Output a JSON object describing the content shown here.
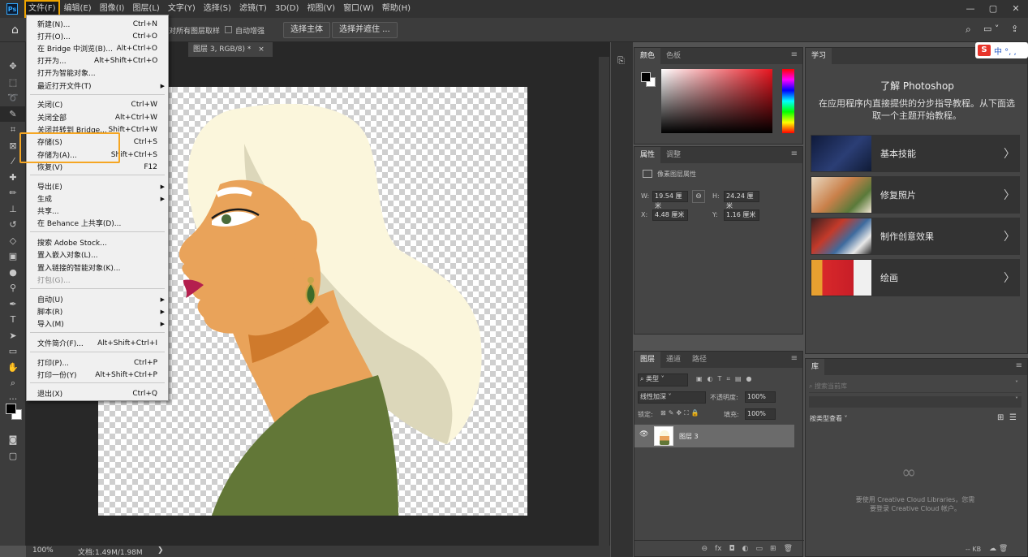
{
  "menubar": {
    "logo": "Ps",
    "items": [
      "文件(F)",
      "编辑(E)",
      "图像(I)",
      "图层(L)",
      "文字(Y)",
      "选择(S)",
      "滤镜(T)",
      "3D(D)",
      "视图(V)",
      "窗口(W)",
      "帮助(H)"
    ],
    "window_controls": [
      "—",
      "▢",
      "✕"
    ]
  },
  "optionsbar": {
    "sample_all": "对所有图层取样",
    "auto_enhance": "自动增强",
    "select_subject": "选择主体",
    "select_and_mask": "选择并遮住 ..."
  },
  "document": {
    "tab_title": "图层 3, RGB/8) *",
    "tab_close": "×",
    "zoom": "100%",
    "doc_info": "文档:1.49M/1.98M",
    "status_arrow": "❯"
  },
  "file_menu": {
    "items": [
      {
        "label": "新建(N)...",
        "shortcut": "Ctrl+N"
      },
      {
        "label": "打开(O)...",
        "shortcut": "Ctrl+O"
      },
      {
        "label": "在 Bridge 中浏览(B)...",
        "shortcut": "Alt+Ctrl+O"
      },
      {
        "label": "打开为...",
        "shortcut": "Alt+Shift+Ctrl+O"
      },
      {
        "label": "打开为智能对象...",
        "shortcut": ""
      },
      {
        "label": "最近打开文件(T)",
        "shortcut": "",
        "submenu": true
      },
      {
        "label": "关闭(C)",
        "shortcut": "Ctrl+W"
      },
      {
        "label": "关闭全部",
        "shortcut": "Alt+Ctrl+W"
      },
      {
        "label": "关闭并转到 Bridge...",
        "shortcut": "Shift+Ctrl+W"
      },
      {
        "label": "存储(S)",
        "shortcut": "Ctrl+S"
      },
      {
        "label": "存储为(A)...",
        "shortcut": "Shift+Ctrl+S"
      },
      {
        "label": "恢复(V)",
        "shortcut": "F12"
      },
      {
        "label": "导出(E)",
        "shortcut": "",
        "submenu": true
      },
      {
        "label": "生成",
        "shortcut": "",
        "submenu": true
      },
      {
        "label": "共享...",
        "shortcut": ""
      },
      {
        "label": "在 Behance 上共享(D)...",
        "shortcut": ""
      },
      {
        "label": "搜索 Adobe Stock...",
        "shortcut": ""
      },
      {
        "label": "置入嵌入对象(L)...",
        "shortcut": ""
      },
      {
        "label": "置入链接的智能对象(K)...",
        "shortcut": ""
      },
      {
        "label": "打包(G)...",
        "shortcut": "",
        "disabled": true
      },
      {
        "label": "自动(U)",
        "shortcut": "",
        "submenu": true
      },
      {
        "label": "脚本(R)",
        "shortcut": "",
        "submenu": true
      },
      {
        "label": "导入(M)",
        "shortcut": "",
        "submenu": true
      },
      {
        "label": "文件简介(F)...",
        "shortcut": "Alt+Shift+Ctrl+I"
      },
      {
        "label": "打印(P)...",
        "shortcut": "Ctrl+P"
      },
      {
        "label": "打印一份(Y)",
        "shortcut": "Alt+Shift+Ctrl+P"
      },
      {
        "label": "退出(X)",
        "shortcut": "Ctrl+Q"
      }
    ],
    "submenu_arrow": "▶"
  },
  "color_panel": {
    "tabs": [
      "颜色",
      "色板"
    ],
    "foreground": "#000000",
    "background": "#ffffff",
    "hue_color": "#e8141e"
  },
  "properties_panel": {
    "tabs": [
      "属性",
      "调整"
    ],
    "subtitle": "像素图层属性",
    "w_label": "W:",
    "w_value": "19.54 厘米",
    "h_label": "H:",
    "h_value": "24.24 厘米",
    "x_label": "X:",
    "x_value": "4.48 厘米",
    "y_label": "Y:",
    "y_value": "1.16 厘米",
    "link_icon": "⊖"
  },
  "layers_panel": {
    "tabs": [
      "图层",
      "通道",
      "路径"
    ],
    "filter_label": "类型",
    "filter_icons": [
      "▣",
      "◐",
      "T",
      "⌗",
      "▤",
      "●"
    ],
    "blend_mode": "线性加深",
    "opacity_label": "不透明度:",
    "opacity_value": "100%",
    "lock_label": "锁定:",
    "lock_icons": [
      "⊠",
      "✎",
      "✥",
      "⛶",
      "🔒"
    ],
    "fill_label": "填充:",
    "fill_value": "100%",
    "layer_name": "图层 3",
    "eye": "👁",
    "footer_icons": [
      "⊖",
      "fx",
      "◘",
      "◐",
      "▭",
      "⊞",
      "🗑"
    ]
  },
  "learn_panel": {
    "tab": "学习",
    "title": "了解 Photoshop",
    "description": "在应用程序内直接提供的分步指导教程。从下面选取一个主题开始教程。",
    "cards": [
      {
        "label": "基本技能",
        "color": "#1d2a55"
      },
      {
        "label": "修复照片",
        "color": "#b39a7a"
      },
      {
        "label": "制作创意效果",
        "color": "#2a4f7a"
      },
      {
        "label": "绘画",
        "color": "#d23b2a"
      }
    ],
    "chevron": "〉"
  },
  "library_panel": {
    "tab": "库",
    "search_placeholder": "搜索当前库",
    "view_label": "按类型查看",
    "message": "要使用 Creative Cloud Libraries，您需要登录 Creative Cloud 帐户。",
    "kb": "-- KB"
  },
  "ime": {
    "logo": "S",
    "text": "中 °, ,"
  },
  "colors": {
    "hair": "#fbf6dc",
    "hair_shade": "#dcd7ba",
    "skin": "#e9a35a",
    "skin_shade": "#cf7a2c",
    "shirt": "#627737",
    "lips": "#b41f4e",
    "accent": "#f5a623"
  }
}
